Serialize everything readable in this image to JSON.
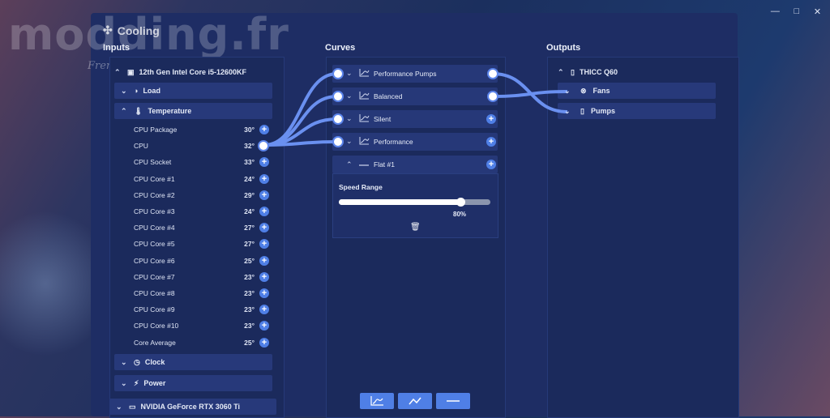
{
  "watermark": {
    "brand": "modding.fr",
    "tagline": "French Modders"
  },
  "window_controls": {
    "minimize": "—",
    "maximize": "□",
    "close": "✕"
  },
  "app": {
    "title": "Cooling"
  },
  "sections": {
    "inputs": "Inputs",
    "curves": "Curves",
    "outputs": "Outputs"
  },
  "inputs": {
    "device": "12th Gen Intel Core i5-12600KF",
    "groups": {
      "load": "Load",
      "temperature": "Temperature",
      "clock": "Clock",
      "power": "Power"
    },
    "sensors": [
      {
        "label": "CPU Package",
        "value": "30°"
      },
      {
        "label": "CPU",
        "value": "32°"
      },
      {
        "label": "CPU Socket",
        "value": "33°"
      },
      {
        "label": "CPU Core #1",
        "value": "24°"
      },
      {
        "label": "CPU Core #2",
        "value": "29°"
      },
      {
        "label": "CPU Core #3",
        "value": "24°"
      },
      {
        "label": "CPU Core #4",
        "value": "27°"
      },
      {
        "label": "CPU Core #5",
        "value": "27°"
      },
      {
        "label": "CPU Core #6",
        "value": "25°"
      },
      {
        "label": "CPU Core #7",
        "value": "23°"
      },
      {
        "label": "CPU Core #8",
        "value": "23°"
      },
      {
        "label": "CPU Core #9",
        "value": "23°"
      },
      {
        "label": "CPU Core #10",
        "value": "23°"
      },
      {
        "label": "Core Average",
        "value": "25°"
      }
    ],
    "gpu_device": "NVIDIA GeForce RTX 3060 Ti"
  },
  "curves": {
    "items": [
      {
        "label": "Performance Pumps"
      },
      {
        "label": "Balanced"
      },
      {
        "label": "Silent"
      },
      {
        "label": "Performance"
      }
    ],
    "flat": {
      "label": "Flat #1",
      "speed_range_label": "Speed Range",
      "value": 80,
      "value_label": "80%"
    }
  },
  "outputs": {
    "device": "THICC Q60",
    "items": [
      {
        "label": "Fans"
      },
      {
        "label": "Pumps"
      }
    ]
  },
  "colors": {
    "accent": "#4f7fe6",
    "panel": "#1b2a5c",
    "card": "#263878"
  }
}
